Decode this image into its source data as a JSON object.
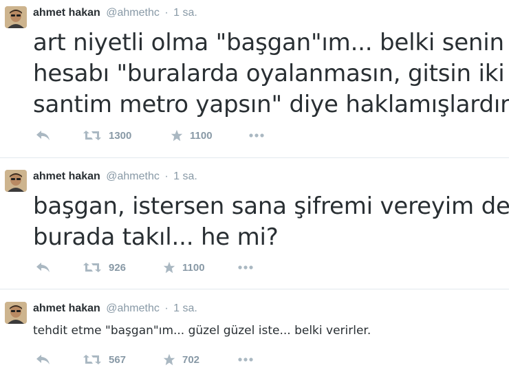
{
  "tweets": [
    {
      "name": "ahmet hakan",
      "handle": "@ahmethc",
      "separator": "·",
      "time": "1 sa.",
      "lines": [
        "art niyetli olma \"başgan\"ım... belki senin",
        "hesabı \"buralarda oyalanmasın, gitsin iki",
        "santim metro yapsın\" diye haklamışlardır."
      ],
      "retweets": "1300",
      "favorites": "1100"
    },
    {
      "name": "ahmet hakan",
      "handle": "@ahmethc",
      "separator": "·",
      "time": "1 sa.",
      "lines": [
        "başgan, istersen sana şifremi vereyim de",
        "burada takıl... he mi?"
      ],
      "retweets": "926",
      "favorites": "1100"
    },
    {
      "name": "ahmet hakan",
      "handle": "@ahmethc",
      "separator": "·",
      "time": "1 sa.",
      "lines": [
        "tehdit etme \"başgan\"ım... güzel güzel iste... belki verirler."
      ],
      "retweets": "567",
      "favorites": "702"
    }
  ],
  "icons": {
    "reply": "reply-icon",
    "retweet": "retweet-icon",
    "favorite": "star-icon",
    "more": "more-icon"
  },
  "colors": {
    "text": "#292f33",
    "meta": "#8899a6",
    "icon": "#aab8c2",
    "divider": "#e1e8ed"
  }
}
